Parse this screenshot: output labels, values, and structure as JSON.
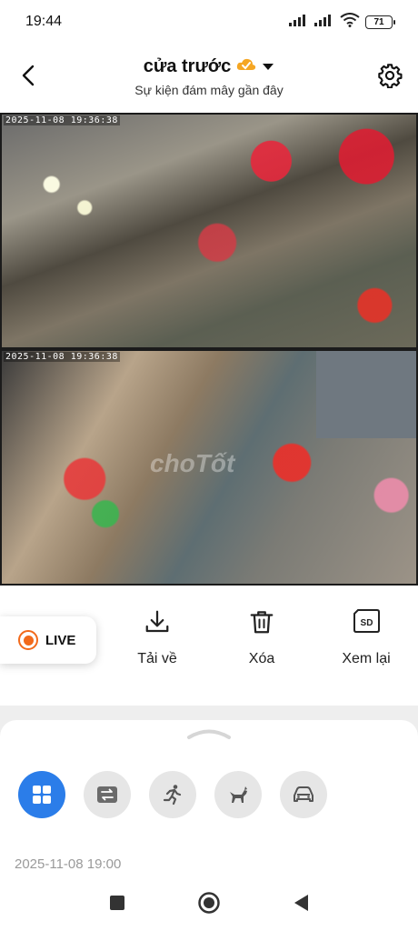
{
  "status_bar": {
    "time": "19:44",
    "battery": "71"
  },
  "header": {
    "title": "cửa trước",
    "subtitle": "Sự kiện đám mây gần đây"
  },
  "video": {
    "timestamp_top": "2025-11-08 19:36:38",
    "timestamp_bottom": "2025-11-08 19:36:38",
    "watermark": "choTốt"
  },
  "controls": {
    "live_label": "LIVE",
    "download_label": "Tải về",
    "delete_label": "Xóa",
    "replay_label": "Xem lại",
    "sd_badge": "SD"
  },
  "events": {
    "date_header": "2025-11-08 19:00",
    "filters": [
      "all-icon",
      "switch-icon",
      "running-person-icon",
      "pet-icon",
      "car-icon"
    ]
  },
  "colors": {
    "accent": "#2b7de9",
    "live": "#f26a1b"
  }
}
